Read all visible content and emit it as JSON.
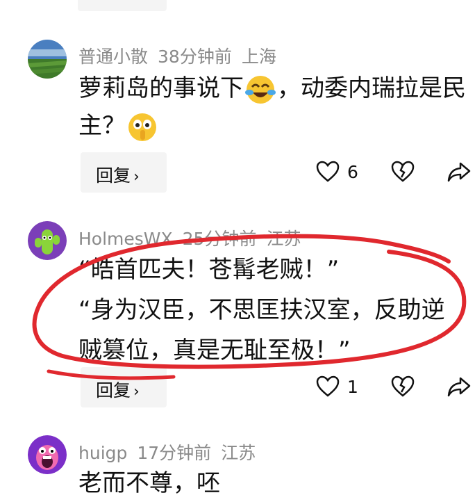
{
  "comments": [
    {
      "username": "普通小散",
      "time": "38分钟前",
      "location": "上海",
      "text_part1": "萝莉岛的事说下",
      "text_part2": "，动委内瑞拉是民主？",
      "reply_label": "回复",
      "likes": "6"
    },
    {
      "username": "HolmesWX",
      "time": "25分钟前",
      "location": "江苏",
      "line1": "“皓首匹夫！苍髯老贼！”",
      "line2": "“身为汉臣，不思匡扶汉室，反助逆",
      "line3": "贼篡位，真是无耻至极！”",
      "reply_label": "回复",
      "likes": "1"
    },
    {
      "username": "huigp",
      "time": "17分钟前",
      "location": "江苏",
      "text": "老而不尊，呸"
    }
  ],
  "icons": {
    "like": "heart-outline-icon",
    "dislike": "broken-heart-icon",
    "share": "share-arrow-icon"
  },
  "colors": {
    "meta_gray": "#8a8a8a",
    "annotation_red": "#e0282e",
    "reply_bg": "#f4f4f4"
  }
}
